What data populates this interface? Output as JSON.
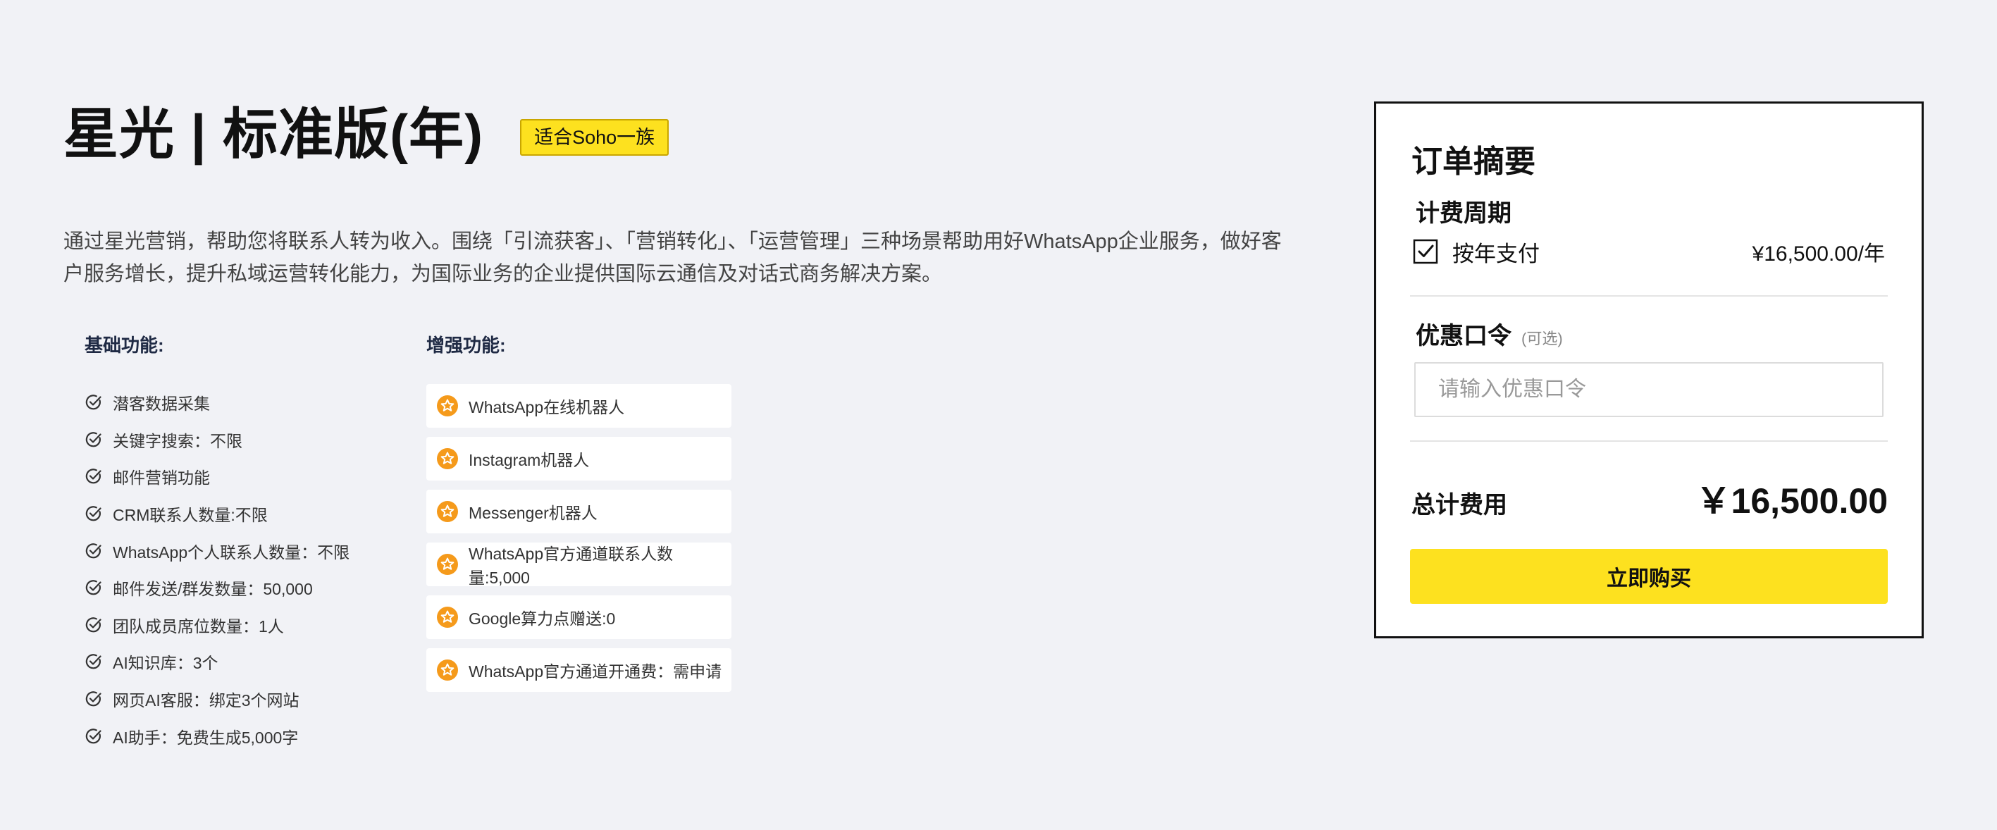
{
  "product": {
    "title": "星光 | 标准版(年)",
    "tag": "适合Soho一族",
    "description": "通过星光营销，帮助您将联系人转为收入。围绕「引流获客」、「营销转化」、「运营管理」三种场景帮助用好WhatsApp企业服务，做好客户服务增长，提升私域运营转化能力，为国际业务的企业提供国际云通信及对话式商务解决方案。"
  },
  "features": {
    "basic_title": "基础功能:",
    "basic": [
      "潜客数据采集",
      "关键字搜索：不限",
      "邮件营销功能",
      "CRM联系人数量:不限",
      "WhatsApp个人联系人数量：不限",
      "邮件发送/群发数量：50,000",
      "团队成员席位数量：1人",
      "AI知识库：3个",
      "网页AI客服：绑定3个网站",
      "AI助手：免费生成5,000字"
    ],
    "enhanced_title": "增强功能:",
    "enhanced": [
      "WhatsApp在线机器人",
      "Instagram机器人",
      "Messenger机器人",
      "WhatsApp官方通道联系人数量:5,000",
      "Google算力点赠送:0",
      "WhatsApp官方通道开通费：需申请"
    ]
  },
  "order": {
    "title": "订单摘要",
    "billing_label": "计费周期",
    "billing_option": "按年支付",
    "billing_price": "¥16,500.00/年",
    "coupon_label": "优惠口令",
    "coupon_optional": "(可选)",
    "coupon_placeholder": "请输入优惠口令",
    "coupon_value": "",
    "total_label": "总计费用",
    "total_value": "￥16,500.00",
    "buy_label": "立即购买"
  },
  "colors": {
    "accent_yellow": "#fde11f",
    "star_orange": "#f59a1b",
    "background": "#f1f2f6"
  },
  "icons": {
    "basic_item": "check-circle-icon",
    "enhanced_item": "star-badge-icon",
    "billing": "checkbox-checked-icon"
  }
}
